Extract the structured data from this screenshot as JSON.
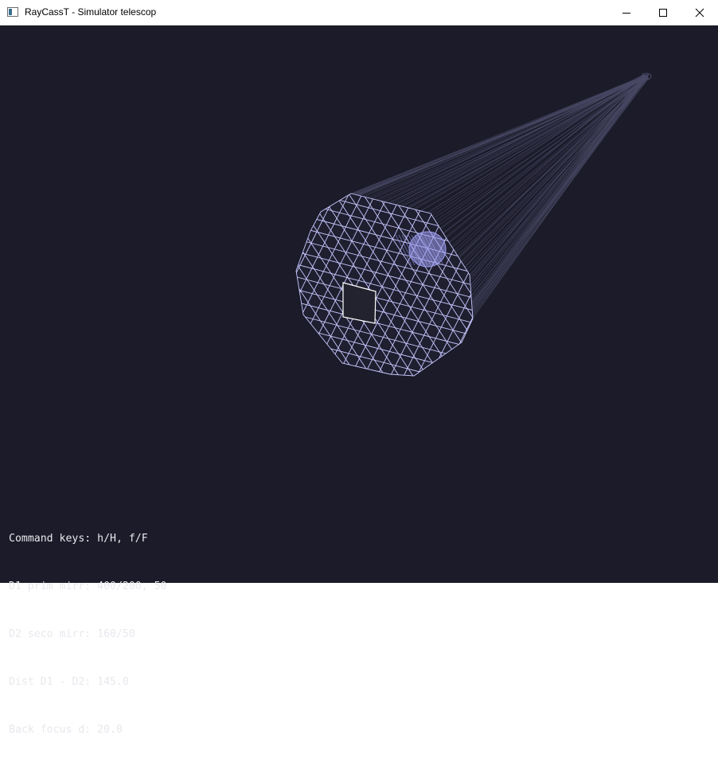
{
  "window": {
    "title": "RayCassT - Simulator telescop",
    "controls": {
      "minimize_icon": "minimize-icon",
      "maximize_icon": "maximize-icon",
      "close_icon": "close-icon"
    }
  },
  "colors": {
    "background": "#1b1b29",
    "mirror_grid": "#c8c8ff",
    "tube": "#4a4a66",
    "secondary_mirror": "#9d9df0",
    "hud_text": "#e8e8ee"
  },
  "hud": {
    "lines": [
      "Command keys: h/H, f/F",
      "D1 prim mirr: 400/200, 50",
      "D2 seco mirr: 160/50",
      "Dist D1 - D2: 145.0",
      "Back focus d: 20.0"
    ]
  }
}
